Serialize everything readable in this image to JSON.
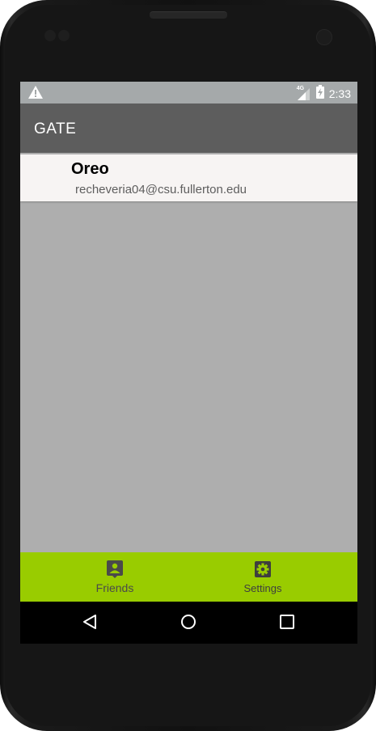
{
  "status_bar": {
    "network": "4G",
    "time": "2:33",
    "icons": [
      "warning-icon",
      "signal-icon",
      "battery-charging-icon"
    ]
  },
  "app_bar": {
    "title": "GATE"
  },
  "friends": [
    {
      "name": "Oreo",
      "email": "recheveria04@csu.fullerton.edu"
    }
  ],
  "bottom_nav": {
    "items": [
      {
        "label": "Friends",
        "icon": "contact-icon"
      },
      {
        "label": "Settings",
        "icon": "settings-gear-icon"
      }
    ]
  },
  "system_nav": {
    "icons": [
      "back-icon",
      "home-icon",
      "recents-icon"
    ]
  },
  "colors": {
    "app_bar": "#5d5d5d",
    "status_bar": "#a5a9aa",
    "bottom_nav": "#99cc00",
    "content_background": "#aeaeae",
    "card": "#f7f4f3"
  }
}
